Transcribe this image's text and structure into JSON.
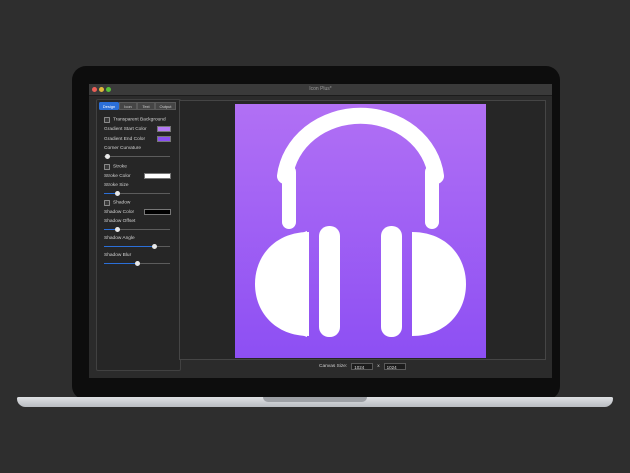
{
  "window": {
    "title": "Icon Plus*"
  },
  "sidebar": {
    "tabs": [
      {
        "label": "Design",
        "active": true
      },
      {
        "label": "Icon",
        "active": false
      },
      {
        "label": "Text",
        "active": false
      },
      {
        "label": "Output",
        "active": false
      }
    ],
    "transparent_background": {
      "label": "Transparent Background",
      "checked": false
    },
    "gradient_start": {
      "label": "Gradient Start Color",
      "color": "#b57bf5"
    },
    "gradient_end": {
      "label": "Gradient End Color",
      "color": "#8a4ff2"
    },
    "corner_curvature": {
      "label": "Corner Curvature",
      "value": 0.0
    },
    "stroke": {
      "label": "Stroke",
      "checked": false
    },
    "stroke_color": {
      "label": "Stroke Color",
      "color": "#ffffff"
    },
    "stroke_size": {
      "label": "Stroke Size",
      "value": 0.2
    },
    "shadow": {
      "label": "Shadow",
      "checked": false
    },
    "shadow_color": {
      "label": "Shadow Color",
      "color": "#000000"
    },
    "shadow_offset": {
      "label": "Shadow Offset",
      "value": 0.2
    },
    "shadow_angle": {
      "label": "Shadow Angle",
      "value": 0.75
    },
    "shadow_blur": {
      "label": "Shadow Blur",
      "value": 0.5
    }
  },
  "canvas": {
    "label": "Canvas Size:",
    "width": "1024",
    "separator": "x",
    "height": "1024",
    "preview_icon": "headphones-icon",
    "gradient_top": "#b170f4",
    "gradient_bottom": "#8d4ff3"
  }
}
